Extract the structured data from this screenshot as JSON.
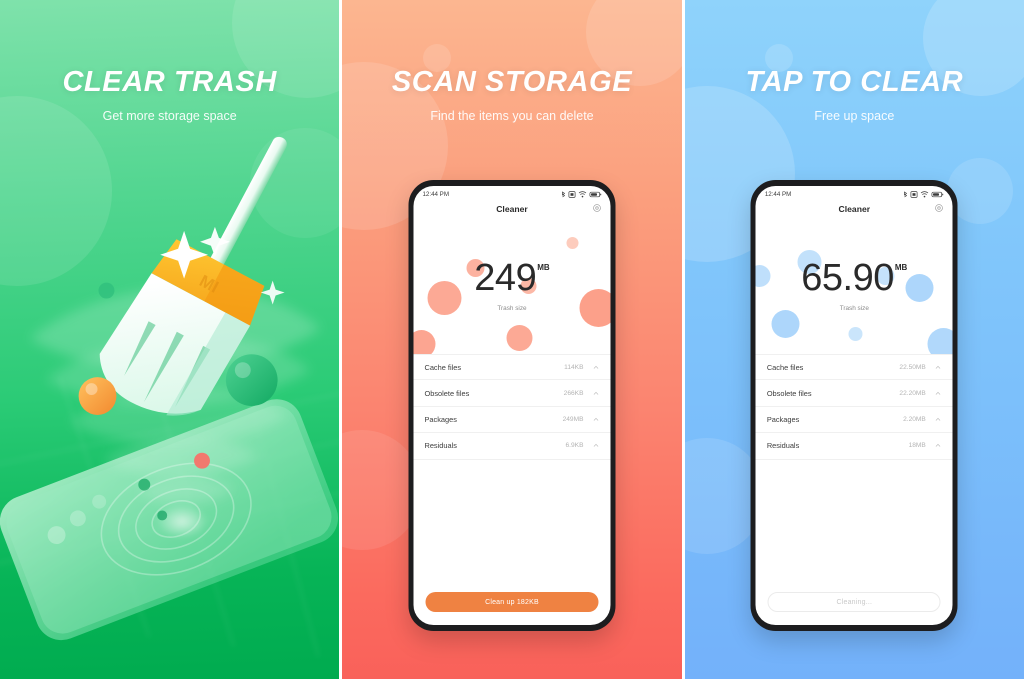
{
  "panels": [
    {
      "id": "clear-trash",
      "title": "CLEAR TRASH",
      "subtitle": "Get more storage space",
      "bg_top": "#7fe2ab",
      "bg_bottom": "#00ab4f",
      "kind": "illustration",
      "illustration": "broom-sweeping-phone-vortex"
    },
    {
      "id": "scan-storage",
      "title": "SCAN STORAGE",
      "subtitle": "Find the items you can delete",
      "bg_top": "#fcb690",
      "bg_bottom": "#f9615a",
      "kind": "phone",
      "accent": "#ef8242",
      "phone": {
        "status_time": "12:44 PM",
        "status_icons": [
          "bluetooth-icon",
          "sim-icon",
          "wifi-icon",
          "battery-icon"
        ],
        "app_title": "Cleaner",
        "settings_icon": "gear-icon",
        "trash_size_value": "249",
        "trash_size_unit": "MB",
        "trash_size_label": "Trash size",
        "rows": [
          {
            "name": "Cache files",
            "size": "114KB"
          },
          {
            "name": "Obsolete files",
            "size": "266KB"
          },
          {
            "name": "Packages",
            "size": "249MB"
          },
          {
            "name": "Residuals",
            "size": "6.9KB"
          }
        ],
        "cta_label": "Clean up 182KB",
        "cta_style": "solid"
      }
    },
    {
      "id": "tap-to-clear",
      "title": "TAP TO CLEAR",
      "subtitle": "Free up space",
      "bg_top": "#8fd3fb",
      "bg_bottom": "#73b1fa",
      "kind": "phone",
      "accent": "#5ea8f7",
      "phone": {
        "status_time": "12:44 PM",
        "status_icons": [
          "bluetooth-icon",
          "sim-icon",
          "wifi-icon",
          "battery-icon"
        ],
        "app_title": "Cleaner",
        "settings_icon": "gear-icon",
        "trash_size_value": "65.90",
        "trash_size_unit": "MB",
        "trash_size_label": "Trash size",
        "rows": [
          {
            "name": "Cache files",
            "size": "22.50MB"
          },
          {
            "name": "Obsolete files",
            "size": "22.20MB"
          },
          {
            "name": "Packages",
            "size": "2.20MB"
          },
          {
            "name": "Residuals",
            "size": "18MB"
          }
        ],
        "cta_label": "Cleaning...",
        "cta_style": "ghost"
      }
    }
  ]
}
